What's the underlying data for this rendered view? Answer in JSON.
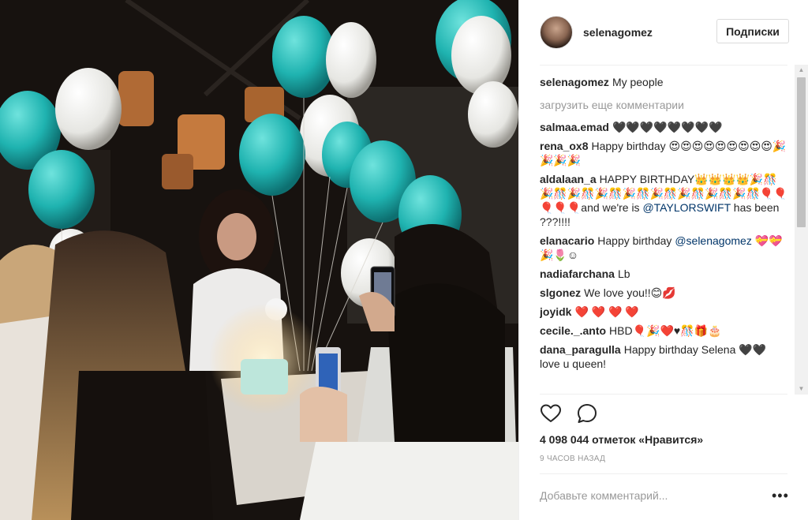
{
  "photo": {
    "alt_label": "",
    "colors": {
      "balloon_teal": "#1fb3b0",
      "balloon_white": "#f2f2f2",
      "background": "#1a1410"
    }
  },
  "header": {
    "username": "selenagomez",
    "follow_label": "Подписки"
  },
  "caption": {
    "author": "selenagomez",
    "text": "My people"
  },
  "load_more_label": "загрузить еще комментарии",
  "comments": [
    {
      "author": "salmaa.emad",
      "text": "🖤🖤🖤🖤🖤🖤🖤🖤"
    },
    {
      "author": "rena_ox8",
      "text": "Happy birthday 😍😍😍😍😍😍😍😍😍🎉🎉🎉🎉"
    },
    {
      "author": "aldalaan_a",
      "text": "HAPPY BIRTHDAY👑👑👑👑🎉🎊🎉🎊🎉🎊🎉🎊🎉🎊🎉🎊🎉🎊🎉🎊🎉🎊🎈🎈🎈🎈🎈and we're is",
      "mention": "@TAYLORSWIFT",
      "text_after": " has been ???!!!!"
    },
    {
      "author": "elanacario",
      "text": "Happy birthday ",
      "mention": "@selenagomez",
      "text_after": " 💝💝🎉🌷☺"
    },
    {
      "author": "nadiafarchana",
      "text": "Lb"
    },
    {
      "author": "slgonez",
      "text": "We love you!!😊💋"
    },
    {
      "author": "joyidk",
      "text": "❤️ ❤️ ❤️ ❤️"
    },
    {
      "author": "cecile._.anto",
      "text": "HBD🎈🎉❤️♥🎊🎁🎂"
    },
    {
      "author": "dana_paragulla",
      "text": "Happy birthday Selena 🖤🖤 love u queen!"
    }
  ],
  "actions": {
    "like_icon": "heart-icon",
    "comment_icon": "comment-icon"
  },
  "likes_text": "4 098 044 отметок «Нравится»",
  "timestamp": "9 ЧАСОВ НАЗАД",
  "add_comment_placeholder": "Добавьте комментарий...",
  "more_label": "•••"
}
